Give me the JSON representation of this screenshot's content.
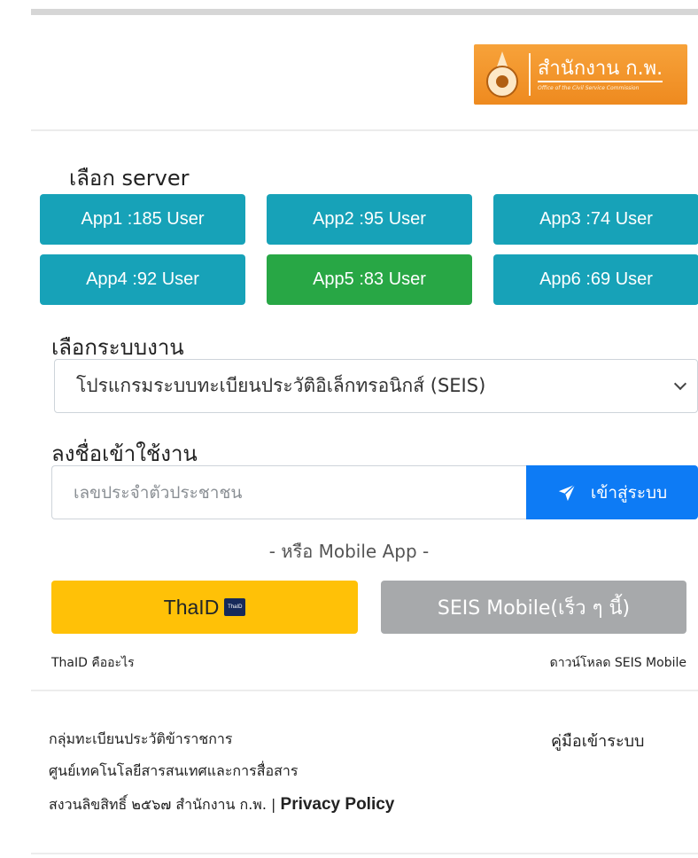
{
  "logo": {
    "title_th": "สำนักงาน ก.พ.",
    "subtitle_en": "Office of the Civil Service Commission"
  },
  "server_section": {
    "label": "เลือก server",
    "servers": [
      {
        "label": "App1 :185 User",
        "active": false
      },
      {
        "label": "App2 :95 User",
        "active": false
      },
      {
        "label": "App3 :74 User",
        "active": false
      },
      {
        "label": "App4 :92 User",
        "active": false
      },
      {
        "label": "App5 :83 User",
        "active": true
      },
      {
        "label": "App6 :69 User",
        "active": false
      }
    ]
  },
  "system_section": {
    "label": "เลือกระบบงาน",
    "selected": "โปรแกรมระบบทะเบียนประวัติอิเล็กทรอนิกส์ (SEIS)"
  },
  "login_section": {
    "label": "ลงชื่อเข้าใช้งาน",
    "id_input": {
      "value": "",
      "placeholder": "เลขประจำตัวประชาชน"
    },
    "login_button": "เข้าสู่ระบบ"
  },
  "mobile": {
    "or_text": "- หรือ Mobile App -",
    "thaid_button": "ThaID",
    "thaid_badge": "ThaID",
    "seis_button": "SEIS Mobile(เร็ว ๆ นี้)",
    "thaid_link": "ThaID คืออะไร",
    "seis_download_link": "ดาวน์โหลด SEIS Mobile"
  },
  "footer": {
    "line1": "กลุ่มทะเบียนประวัติข้าราชการ",
    "line2": "ศูนย์เทคโนโลยีสารสนเทศและการสื่อสาร",
    "copyright": "สงวนลิขสิทธิ์ ๒๕๖๗ สำนักงาน ก.พ. |",
    "privacy": "Privacy Policy",
    "manual_link": "คู่มือเข้าระบบ"
  },
  "colors": {
    "server_default": "#17a2b8",
    "server_active": "#28a745",
    "login_button": "#0d7bf5",
    "thaid_button": "#ffc107",
    "seis_button": "#a7a9ab",
    "logo_bg": "#ee8a1f"
  },
  "icons": {
    "login_button_icon": "paper-plane-icon",
    "select_icon": "chevron-down-icon",
    "logo_emblem": "ocsc-emblem-icon"
  }
}
